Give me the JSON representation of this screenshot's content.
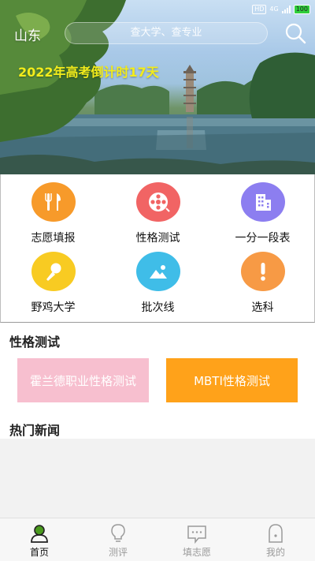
{
  "status_bar": {
    "hd": "HD",
    "network": "4G",
    "battery": "100"
  },
  "header": {
    "location": "山东",
    "search_placeholder": "查大学、查专业",
    "countdown": "2022年高考倒计时17天"
  },
  "menu": [
    {
      "label": "志愿填报",
      "icon": "utensils-icon",
      "color": "#f79a2a"
    },
    {
      "label": "性格测试",
      "icon": "film-reel-icon",
      "color": "#f16464"
    },
    {
      "label": "一分一段表",
      "icon": "building-icon",
      "color": "#8c7ef0"
    },
    {
      "label": "野鸡大学",
      "icon": "microphone-icon",
      "color": "#f8cb22"
    },
    {
      "label": "批次线",
      "icon": "image-icon",
      "color": "#3fbde8"
    },
    {
      "label": "选科",
      "icon": "exclamation-icon",
      "color": "#f79a45"
    }
  ],
  "personality": {
    "title": "性格测试",
    "holland_label": "霍兰德职业性格测试",
    "mbti_label": "MBTI性格测试",
    "holland_color": "#f7bfcf",
    "mbti_color": "#ffa21a"
  },
  "news": {
    "title": "热门新闻"
  },
  "tabs": [
    {
      "label": "首页",
      "icon": "home-person-icon",
      "active": true
    },
    {
      "label": "测评",
      "icon": "lightbulb-icon",
      "active": false
    },
    {
      "label": "填志愿",
      "icon": "chat-bubble-icon",
      "active": false
    },
    {
      "label": "我的",
      "icon": "user-icon",
      "active": false
    }
  ]
}
